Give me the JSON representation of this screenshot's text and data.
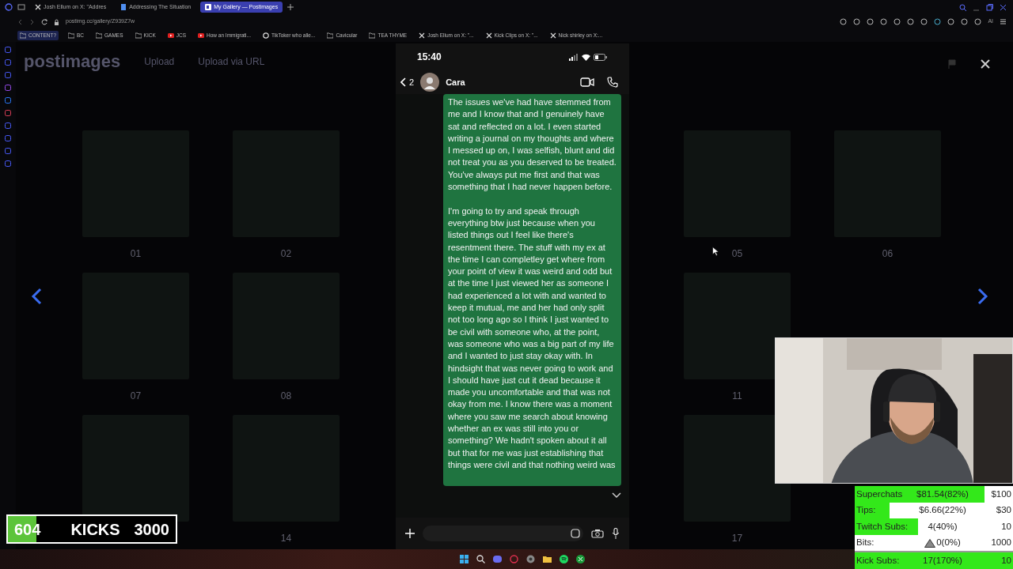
{
  "browser": {
    "tabs": [
      {
        "label": "Josh Ellum on X: \"Addres",
        "selected": false,
        "kind": "x"
      },
      {
        "label": "Addressing The Situation",
        "selected": false,
        "kind": "doc"
      },
      {
        "label": "My Gallery — Postimages",
        "selected": true,
        "kind": "postimages"
      }
    ],
    "address": "postimg.cc/gallery/Z939Z7w",
    "bookmarks": [
      {
        "label": "CONTENT?",
        "kind": "folder",
        "selected": true
      },
      {
        "label": "BC",
        "kind": "folder",
        "selected": false
      },
      {
        "label": "GAMES",
        "kind": "folder",
        "selected": false
      },
      {
        "label": "KICK",
        "kind": "folder",
        "selected": false
      },
      {
        "label": "JCS",
        "kind": "video",
        "selected": false
      },
      {
        "label": "How an Immigrati...",
        "kind": "video",
        "selected": false
      },
      {
        "label": "TikToker who alle...",
        "kind": "g",
        "selected": false
      },
      {
        "label": "Cavicular",
        "kind": "folder",
        "selected": false
      },
      {
        "label": "TEA THYME",
        "kind": "folder",
        "selected": false
      },
      {
        "label": "Josh Ellum on X: \"...",
        "kind": "x",
        "selected": false
      },
      {
        "label": "Kick Clips on X: \"...",
        "kind": "x",
        "selected": false
      },
      {
        "label": "Nick shirley on X:...",
        "kind": "x",
        "selected": false
      }
    ],
    "toolbar_label": "AI"
  },
  "gallery": {
    "logo": "postimages",
    "nav": [
      "Upload",
      "Upload via URL"
    ],
    "columns": [
      [
        {
          "kind": "thumbnail",
          "number": "01"
        },
        {
          "kind": "thumbnail",
          "number": "07"
        },
        {
          "kind": "thumbnail"
        }
      ],
      [
        {
          "kind": "thumbnail",
          "number": "02"
        },
        {
          "kind": "thumbnail",
          "number": "08"
        },
        {
          "kind": "thumbnail",
          "number": "14"
        }
      ],
      [
        {
          "kind": "thumbnail",
          "number": "05"
        },
        {
          "kind": "thumbnail",
          "number": "11"
        },
        {
          "kind": "thumbnail",
          "number": "17"
        }
      ],
      [
        {
          "kind": "thumbnail",
          "number": "06"
        }
      ]
    ]
  },
  "phone": {
    "time": "15:40",
    "back_count": "2",
    "contact": "Cara",
    "messages": [
      "The issues we've had have stemmed from me and I know that and I genuinely have sat and reflected on a lot. I even started writing a journal on my thoughts and where I messed up on, I was selfish, blunt and did not treat you as you deserved to be treated. You've always put me first and that was something that I had never happen before.",
      "I'm going to try and speak through everything btw just because when you listed things out I feel like there's resentment there. The stuff with my ex at the time I can completley get where from your point of view it was weird and odd but at the time I just viewed her as someone I had experienced a lot with and wanted to keep it mutual, me and her had only split not too long ago so I think I just wanted to be civil with someone who, at the point, was someone who was a big part of my life and I wanted to just stay okay with. In hindsight that was never going to work and I should have just cut it dead because it made you uncomfortable and that was not okay from me. I know there was a moment where you saw me search about knowing whether an ex was still into you or something? We hadn't spoken about it all but that for me was just establishing that things were civil and that nothing weird was"
    ]
  },
  "stats": [
    {
      "label": "Superchats",
      "value": "$81.54(82%)",
      "goal": "$100",
      "level": 0.82,
      "kind": "plain"
    },
    {
      "label": "Tips:",
      "value": "$6.66(22%)",
      "goal": "$30",
      "level": 0.22,
      "kind": "plain"
    },
    {
      "label": "Twitch Subs:",
      "value": "4(40%)",
      "goal": "10",
      "level": 0.4,
      "kind": "plain"
    },
    {
      "label": "Bits:",
      "value": "0(0%)",
      "goal": "1000",
      "level": 0,
      "kind": "bits"
    },
    {
      "label": "Kick Subs:",
      "value": "17(170%)",
      "goal": "10",
      "level": 1,
      "kind": "plain"
    }
  ],
  "kicks": {
    "count": "604",
    "label": "KICKS",
    "goal": "3000",
    "level": 0.17
  }
}
